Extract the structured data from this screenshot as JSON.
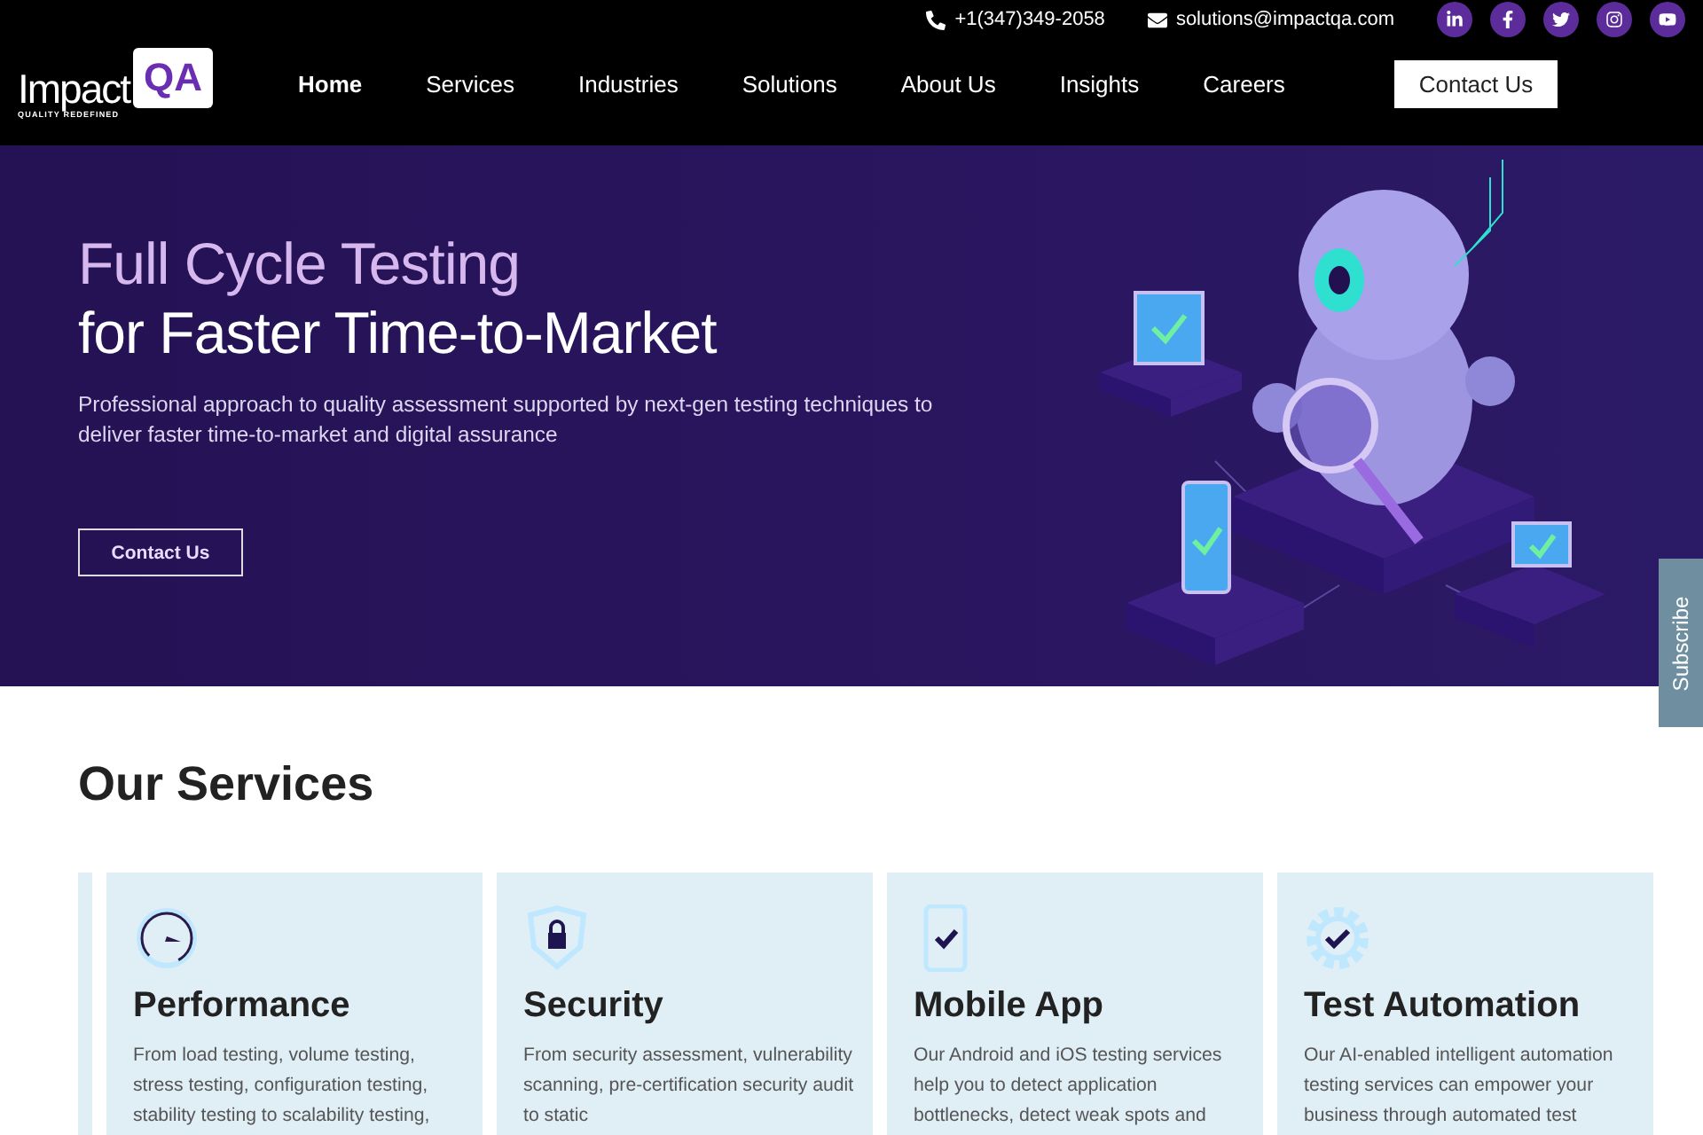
{
  "contact_bar": {
    "phone": "+1(347)349-2058",
    "email": "solutions@impactqa.com",
    "social": [
      {
        "kind": "linkedin"
      },
      {
        "kind": "facebook"
      },
      {
        "kind": "twitter"
      },
      {
        "kind": "instagram"
      },
      {
        "kind": "youtube"
      }
    ]
  },
  "logo": {
    "name": "Impact",
    "mark": "QA",
    "tagline": "QUALITY REDEFINED"
  },
  "nav": [
    {
      "label": "Home",
      "selected": true
    },
    {
      "label": "Services",
      "selected": false
    },
    {
      "label": "Industries",
      "selected": false
    },
    {
      "label": "Solutions",
      "selected": false
    },
    {
      "label": "About Us",
      "selected": false
    },
    {
      "label": "Insights",
      "selected": false
    },
    {
      "label": "Careers",
      "selected": false
    }
  ],
  "nav_button": "Contact Us",
  "hero": {
    "title_line_1": "Full Cycle Testing",
    "title_line_2": "for Faster Time-to-Market",
    "text": "Professional approach to quality assessment supported by next-gen testing techniques to deliver faster time-to-market and digital assurance",
    "button": "Contact Us"
  },
  "subscribe_tab": "Subscribe",
  "services": {
    "title": "Our Services",
    "cards": [
      {
        "kind": "gauge",
        "title": "Performance",
        "text": "From load testing, volume testing, stress testing, configuration testing, stability testing to scalability testing,"
      },
      {
        "kind": "shield",
        "title": "Security",
        "text": "From security assessment, vulnerability scanning, pre-certification security audit to static"
      },
      {
        "kind": "phone",
        "title": "Mobile App",
        "text": "Our Android and iOS testing services help you to detect application bottlenecks, detect weak spots and"
      },
      {
        "kind": "gear",
        "title": "Test Automation",
        "text": "Our AI-enabled intelligent automation testing services can empower your business through automated test"
      }
    ]
  }
}
